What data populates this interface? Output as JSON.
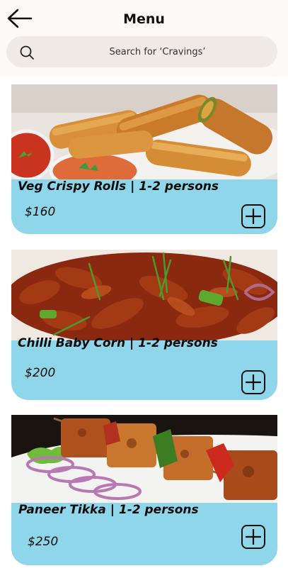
{
  "header": {
    "title": "Menu",
    "back_icon": "arrow-left-icon"
  },
  "search": {
    "placeholder": "Search for ‘Cravings’",
    "icon": "search-icon"
  },
  "menu": {
    "items": [
      {
        "name": "Veg Crispy Rolls  | 1-2 persons",
        "price": "$160",
        "photo": "spring-rolls"
      },
      {
        "name": "Chilli Baby Corn | 1-2 persons",
        "price": "$200",
        "photo": "chilli-baby-corn"
      },
      {
        "name": "Paneer Tikka  | 1-2 persons",
        "price": "$250",
        "photo": "paneer-tikka"
      }
    ]
  },
  "colors": {
    "card_bg": "#8fd6ea",
    "header_bg": "#fcfaf8",
    "search_bg": "#f1ebe8"
  }
}
